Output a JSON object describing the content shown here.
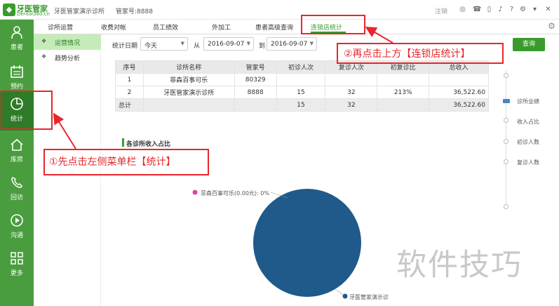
{
  "titlebar": {
    "logo_name": "牙医管家",
    "logo_site": "Dental360.cn",
    "clinic_name": "牙医管家演示诊所",
    "account": "管家号:8888",
    "logout": "注销",
    "icons": [
      "wechat-icon",
      "phone-icon",
      "mobile-icon",
      "bell-icon",
      "help-icon",
      "settings-icon",
      "minimize-icon",
      "close-icon"
    ]
  },
  "leftnav": {
    "items": [
      {
        "label": "患者",
        "icon": "person-icon"
      },
      {
        "label": "预约",
        "icon": "calendar-icon"
      },
      {
        "label": "统计",
        "icon": "pie-chart-icon"
      },
      {
        "label": "库房",
        "icon": "home-icon"
      },
      {
        "label": "回访",
        "icon": "phone-icon"
      },
      {
        "label": "沟通",
        "icon": "play-icon"
      },
      {
        "label": "更多",
        "icon": "grid-icon"
      }
    ]
  },
  "tabs": [
    "诊所运营",
    "收费对帐",
    "员工绩效",
    "外加工",
    "患者高级查询",
    "连锁店统计"
  ],
  "submenu": {
    "items": [
      "运营情况",
      "趋势分析"
    ]
  },
  "filter": {
    "label": "统计日期",
    "period": "今天",
    "from_label": "从",
    "from_date": "2016-09-07",
    "to_label": "到",
    "to_date": "2016-09-07",
    "query_button": "查询"
  },
  "table": {
    "headers": [
      "序号",
      "诊所名称",
      "管家号",
      "初诊人次",
      "复诊人次",
      "初复诊比",
      "总收入"
    ],
    "rows": [
      [
        "1",
        "菲森百事可乐",
        "80329",
        "",
        "",
        "",
        ""
      ],
      [
        "2",
        "牙医管家演示诊所",
        "8888",
        "15",
        "32",
        "213%",
        "36,522.60"
      ]
    ],
    "total": [
      "总计",
      "",
      "",
      "15",
      "32",
      "",
      "36,522.60"
    ]
  },
  "chart": {
    "title": "各诊所收入占比"
  },
  "chart_data": {
    "type": "pie",
    "title": "各诊所收入占比",
    "slices": [
      {
        "label": "菲森百事可乐(0.00元): 0%",
        "name": "菲森百事可乐",
        "value": 0,
        "color": "#e040a0"
      },
      {
        "label": "牙医管家演示诊",
        "name": "牙医管家演示诊所",
        "value": 36522.6,
        "color": "#1f5a8a"
      }
    ]
  },
  "right_legend": {
    "items": [
      "诊所业绩",
      "收入占比",
      "初诊人数",
      "复诊人数"
    ]
  },
  "annotations": {
    "left": "①先点击左侧菜单栏【统计】",
    "top": "②再点击上方【连锁店统计】"
  },
  "watermark": "软件技巧",
  "colors": {
    "brand_green": "#4a9d3f",
    "active_green": "#2f7b27",
    "annotation_red": "#e8262a",
    "pie_blue": "#1f5a8a"
  }
}
